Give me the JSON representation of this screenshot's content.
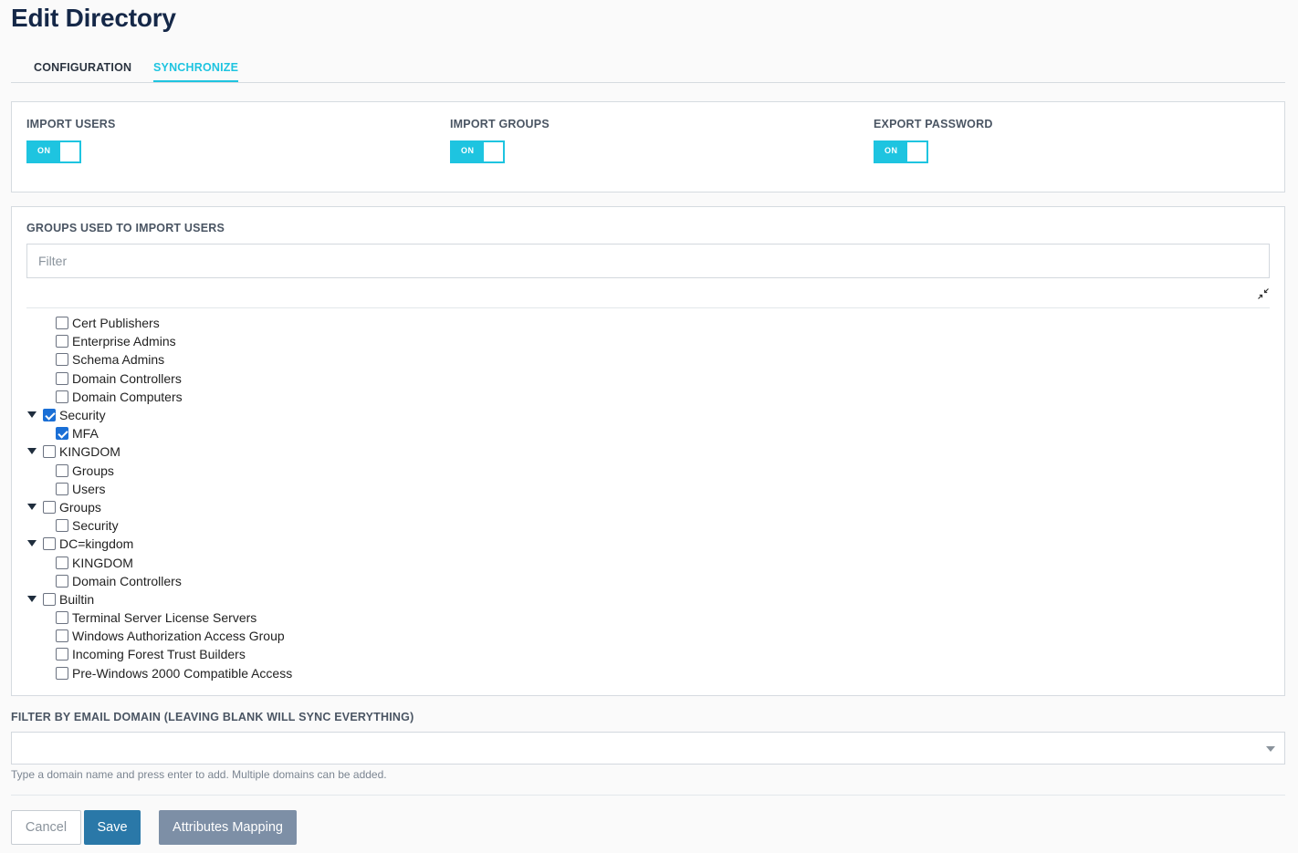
{
  "page": {
    "title": "Edit Directory"
  },
  "tabs": [
    {
      "label": "CONFIGURATION",
      "active": false
    },
    {
      "label": "SYNCHRONIZE",
      "active": true
    }
  ],
  "toggles": [
    {
      "label": "IMPORT USERS",
      "state": "ON"
    },
    {
      "label": "IMPORT GROUPS",
      "state": "ON"
    },
    {
      "label": "EXPORT PASSWORD",
      "state": "ON"
    }
  ],
  "groups": {
    "heading": "GROUPS USED TO IMPORT USERS",
    "filter_placeholder": "Filter",
    "tree": [
      {
        "label": "Cert Publishers",
        "level": "child",
        "checked": false
      },
      {
        "label": "Enterprise Admins",
        "level": "child",
        "checked": false
      },
      {
        "label": "Schema Admins",
        "level": "child",
        "checked": false
      },
      {
        "label": "Domain Controllers",
        "level": "child",
        "checked": false
      },
      {
        "label": "Domain Computers",
        "level": "child",
        "checked": false
      },
      {
        "label": "Security",
        "level": "parent",
        "checked": true
      },
      {
        "label": "MFA",
        "level": "child",
        "checked": true
      },
      {
        "label": "KINGDOM",
        "level": "parent",
        "checked": false
      },
      {
        "label": "Groups",
        "level": "child",
        "checked": false
      },
      {
        "label": "Users",
        "level": "child",
        "checked": false
      },
      {
        "label": "Groups",
        "level": "parent",
        "checked": false
      },
      {
        "label": "Security",
        "level": "child",
        "checked": false
      },
      {
        "label": "DC=kingdom",
        "level": "parent",
        "checked": false
      },
      {
        "label": "KINGDOM",
        "level": "child",
        "checked": false
      },
      {
        "label": "Domain Controllers",
        "level": "child",
        "checked": false
      },
      {
        "label": "Builtin",
        "level": "parent",
        "checked": false
      },
      {
        "label": "Terminal Server License Servers",
        "level": "child",
        "checked": false
      },
      {
        "label": "Windows Authorization Access Group",
        "level": "child",
        "checked": false
      },
      {
        "label": "Incoming Forest Trust Builders",
        "level": "child",
        "checked": false
      },
      {
        "label": "Pre-Windows 2000 Compatible Access",
        "level": "child",
        "checked": false
      }
    ]
  },
  "email_filter": {
    "label": "FILTER BY EMAIL DOMAIN (LEAVING BLANK WILL SYNC EVERYTHING)",
    "value": "",
    "help": "Type a domain name and press enter to add. Multiple domains can be added."
  },
  "buttons": {
    "cancel": "Cancel",
    "save": "Save",
    "attributes": "Attributes Mapping"
  },
  "colors": {
    "accent": "#1ec4e0",
    "title": "#152848",
    "save": "#2a78a8",
    "secondary": "#7d8fa6",
    "checkbox_checked": "#1a6fd6"
  }
}
